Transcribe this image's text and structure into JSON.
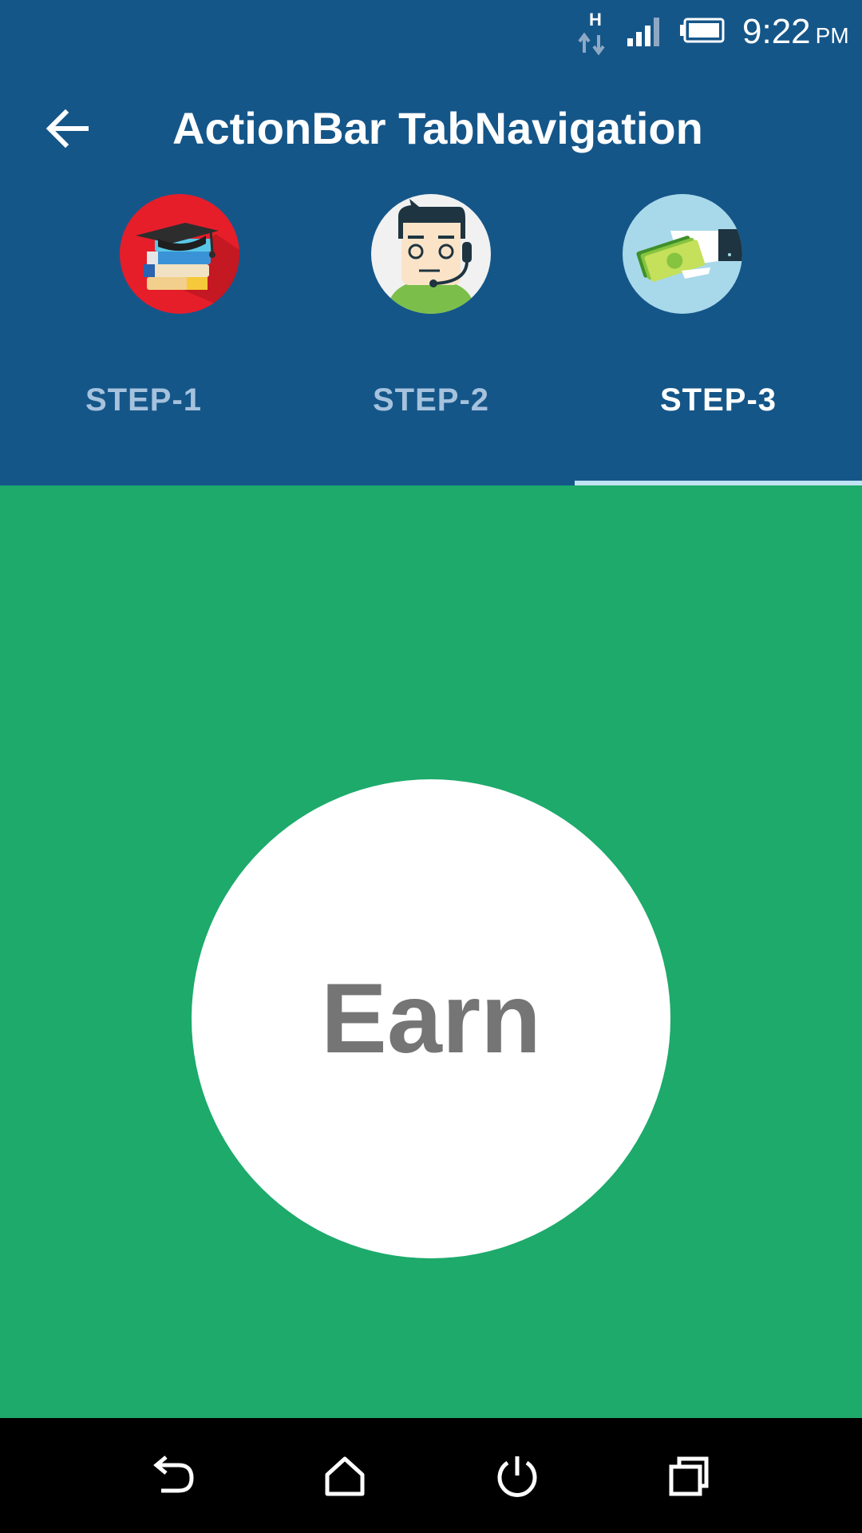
{
  "status_bar": {
    "network_type": "H",
    "time": "9:22",
    "ampm": "PM",
    "icons": [
      "data-transfer-icon",
      "signal-icon",
      "battery-icon"
    ]
  },
  "action_bar": {
    "back_icon": "arrow-back-icon",
    "title": "ActionBar TabNavigation",
    "background": "#155689"
  },
  "tabs": [
    {
      "label": "STEP-1",
      "icon": "books-graduation-cap-icon",
      "active": false
    },
    {
      "label": "STEP-2",
      "icon": "support-agent-headset-icon",
      "active": false
    },
    {
      "label": "STEP-3",
      "icon": "money-hand-icon",
      "active": true
    }
  ],
  "content": {
    "button_label": "Earn",
    "background": "#1daa6b"
  },
  "nav_bar": {
    "buttons": [
      "back-nav-icon",
      "home-icon",
      "power-icon",
      "recents-icon"
    ]
  }
}
